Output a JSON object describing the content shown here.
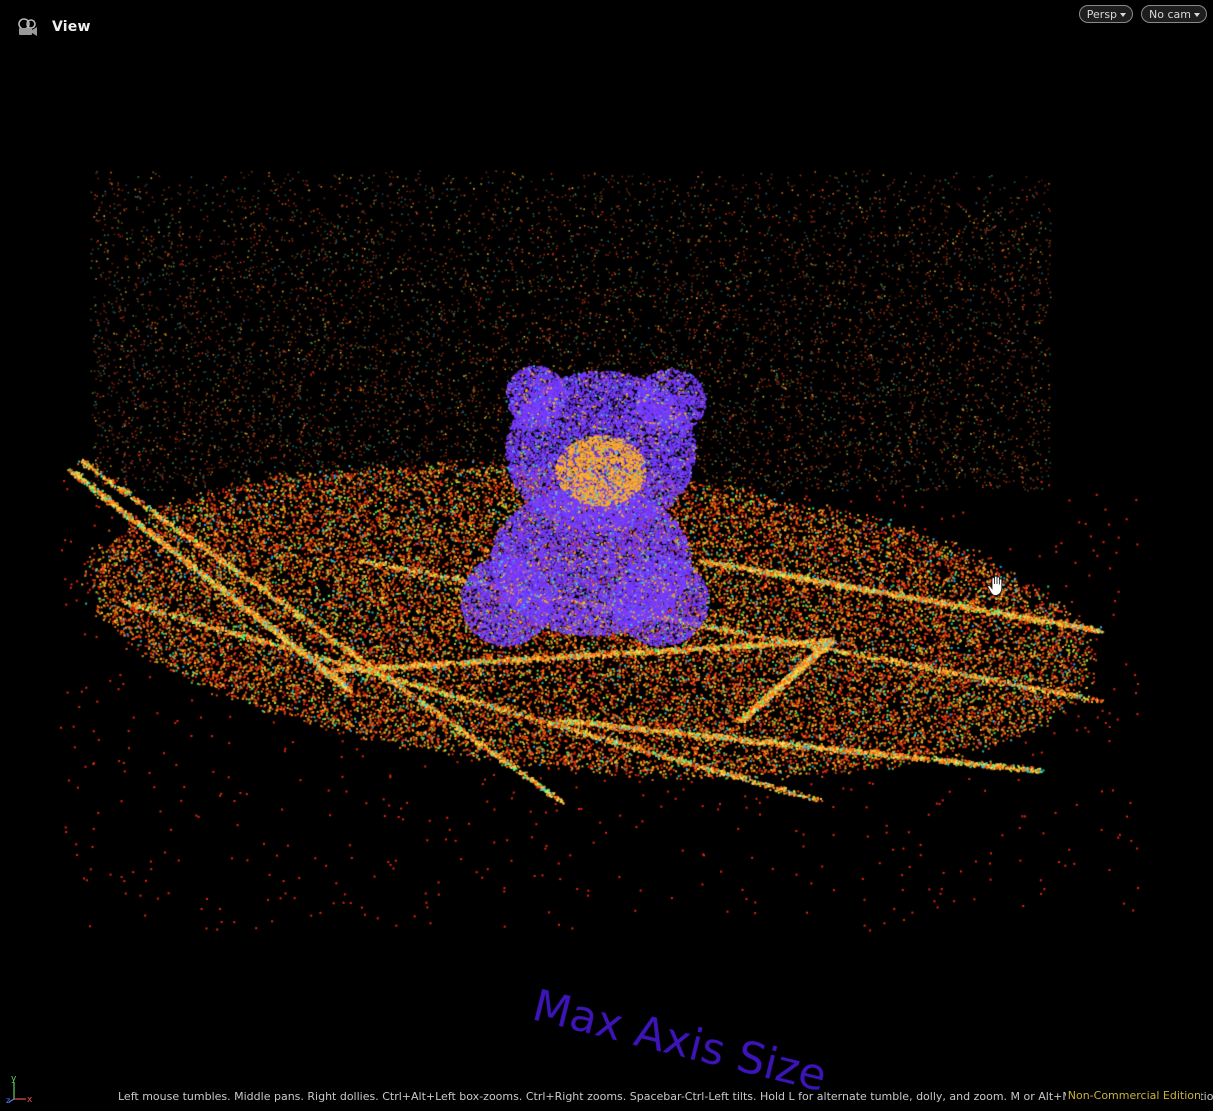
{
  "header": {
    "title": "View",
    "icon": "camera-reel-icon"
  },
  "controls": {
    "projection": "Persp",
    "camera": "No cam"
  },
  "viewport": {
    "watermark": "Max Axis Size",
    "axis_labels": {
      "y": "y",
      "x": "x",
      "z": "z"
    },
    "cursor": "hand-pan-icon"
  },
  "status_bar": {
    "hint": "Left mouse tumbles. Middle pans. Right dollies. Ctrl+Alt+Left box-zooms. Ctrl+Right zooms. Spacebar-Ctrl-Left tilts. Hold L for alternate tumble, dolly, and zoom. M or Alt+M for First Person Navigation.",
    "edition": "Non-Commercial Edition"
  },
  "colors": {
    "background": "#000000",
    "bear_points": "#7a3cff",
    "floor_points": "#ff3a10",
    "highlight_points": "#ffd23a",
    "accent_points": "#38e0c8",
    "watermark": "#3d14b8",
    "edition_text": "#c8b23a"
  }
}
